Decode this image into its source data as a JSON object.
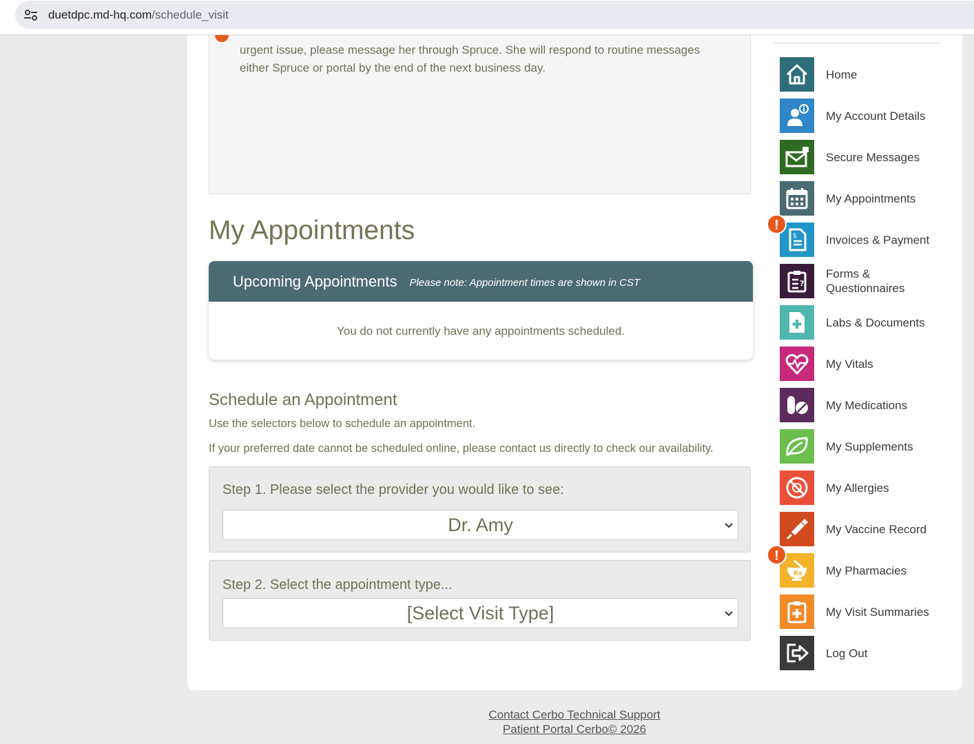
{
  "browser": {
    "url_host": "duetdpc.md-hq.com",
    "url_path": "/schedule_visit"
  },
  "notice": {
    "text": "urgent issue, please message her through Spruce.  She will respond to routine messages either Spruce or portal by the end of the next business day."
  },
  "page_title": "My Appointments",
  "upcoming": {
    "title": "Upcoming Appointments",
    "note": "Please note: Appointment times are shown in CST",
    "empty_message": "You do not currently have any appointments scheduled."
  },
  "schedule": {
    "title": "Schedule an Appointment",
    "instructions": "Use the selectors below to schedule an appointment.",
    "contact_note": "If your preferred date cannot be scheduled online, please contact us directly to check our availability.",
    "step1": {
      "label": "Step 1. Please select the provider you would like to see:",
      "selected": "Dr. Amy"
    },
    "step2": {
      "label": "Step 2. Select the appointment type...",
      "selected": "[Select Visit Type]"
    }
  },
  "sidebar": {
    "items": [
      {
        "label": "Home",
        "icon": "home-icon",
        "color": "#2e6e7a"
      },
      {
        "label": "My Account Details",
        "icon": "account-details-icon",
        "color": "#2f86c8"
      },
      {
        "label": "Secure Messages",
        "icon": "secure-mail-icon",
        "color": "#2f6b22"
      },
      {
        "label": "My Appointments",
        "icon": "calendar-icon",
        "color": "#4b6b73"
      },
      {
        "label": "Invoices & Payment",
        "icon": "invoice-icon",
        "color": "#2196c9",
        "alert": "!"
      },
      {
        "label": "Forms & Questionnaires",
        "icon": "questionnaire-icon",
        "color": "#3a1b3a"
      },
      {
        "label": "Labs & Documents",
        "icon": "lab-document-icon",
        "color": "#4fb6b0"
      },
      {
        "label": "My Vitals",
        "icon": "heart-pulse-icon",
        "color": "#c72a7a"
      },
      {
        "label": "My Medications",
        "icon": "pills-icon",
        "color": "#5c2a5c"
      },
      {
        "label": "My Supplements",
        "icon": "leaf-icon",
        "color": "#6bbf4e"
      },
      {
        "label": "My Allergies",
        "icon": "no-allergy-icon",
        "color": "#ea4f37"
      },
      {
        "label": "My Vaccine Record",
        "icon": "syringe-icon",
        "color": "#d24a1f"
      },
      {
        "label": "My Pharmacies",
        "icon": "mortar-pestle-icon",
        "color": "#f3b32a",
        "alert": "!"
      },
      {
        "label": "My Visit Summaries",
        "icon": "clipboard-plus-icon",
        "color": "#f28a28"
      },
      {
        "label": "Log Out",
        "icon": "logout-icon",
        "color": "#3a3a3a"
      }
    ]
  },
  "footer": {
    "support_link": "Contact Cerbo Technical Support",
    "copyright": "Patient Portal Cerbo© 2026"
  }
}
